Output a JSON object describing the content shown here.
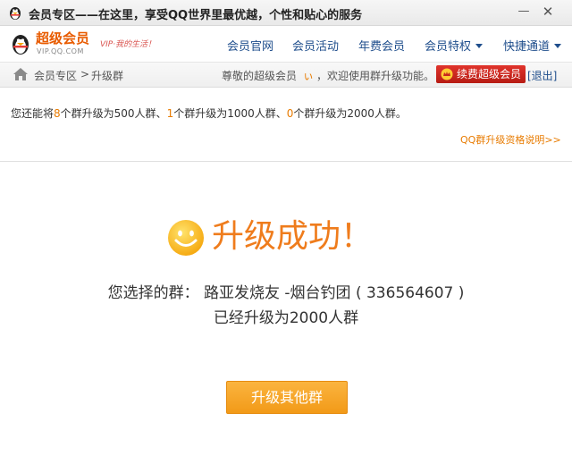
{
  "window": {
    "title": "会员专区——在这里，享受QQ世界里最优越，个性和贴心的服务",
    "minimize_glyph": "—",
    "close_glyph": "✕"
  },
  "logo": {
    "name": "超级会员",
    "url": "VIP.QQ.COM",
    "slogan": "VIP·我的生活！"
  },
  "nav": {
    "items": [
      {
        "label": "会员官网"
      },
      {
        "label": "会员活动"
      },
      {
        "label": "年费会员"
      },
      {
        "label": "会员特权"
      },
      {
        "label": "快捷通道"
      }
    ]
  },
  "breadcrumb": {
    "home": "会员专区",
    "separator": ">",
    "current": "升级群"
  },
  "greeting": {
    "prefix": "尊敬的超级会员",
    "name": "ぃ",
    "suffix": "，欢迎使用群升级功能。",
    "renew_label": "续费超级会员",
    "logout_label": "[退出]"
  },
  "summary": {
    "t1": "您还能将",
    "n1": "8",
    "t2": "个群升级为500人群、",
    "n2": "1",
    "t3": "个群升级为1000人群、",
    "n3": "0",
    "t4": "个群升级为2000人群。"
  },
  "info_link": "QQ群升级资格说明>>",
  "result": {
    "title": "升级成功！",
    "chosen_line": "您选择的群： 路亚发烧友 -烟台钓团 ( 336564607 )",
    "upgraded_line": "已经升级为2000人群"
  },
  "actions": {
    "upgrade_other_label": "升级其他群"
  },
  "colors": {
    "accent_orange": "#ef7c1c",
    "link_blue": "#1f4e8c",
    "renew_red": "#c8261e"
  },
  "icons": [
    "qq-penguin-icon",
    "home-icon",
    "crown-icon",
    "smiley-icon",
    "chevron-down-icon"
  ]
}
